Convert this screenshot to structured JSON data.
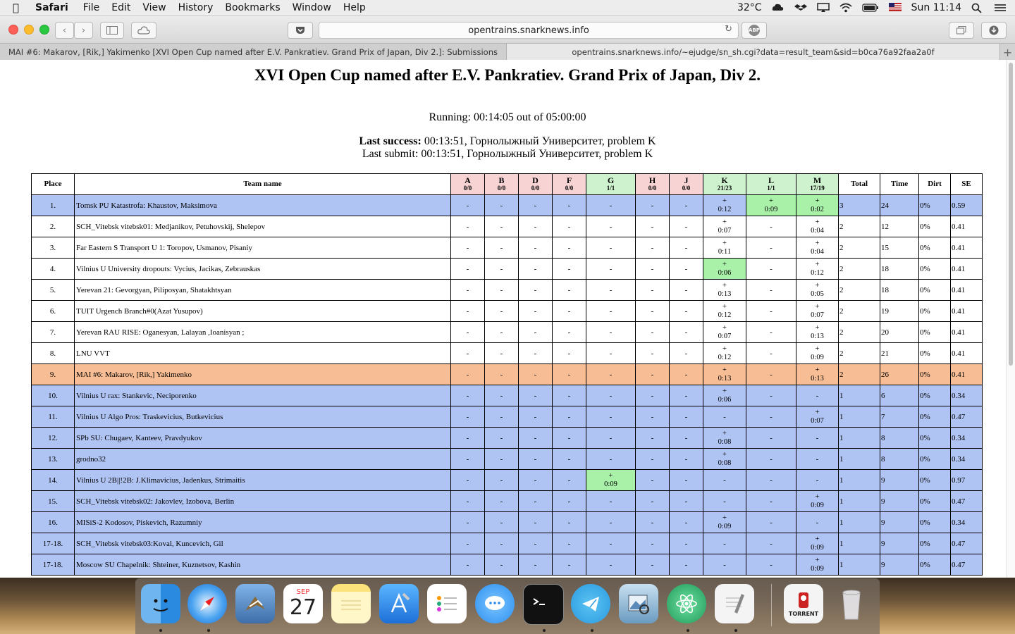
{
  "menubar": {
    "app": "Safari",
    "items": [
      "File",
      "Edit",
      "View",
      "History",
      "Bookmarks",
      "Window",
      "Help"
    ],
    "temperature": "32°C",
    "clock": "Sun 11:14"
  },
  "browser": {
    "url": "opentrains.snarknews.info",
    "tabs": [
      "MAI #6: Makarov, [Rik,] Yakimenko [XVI Open Cup named after E.V. Pankratiev. Grand Prix of Japan, Div 2.]: Submissions",
      "opentrains.snarknews.info/~ejudge/sn_sh.cgi?data=result_team&sid=b0ca76a92faa2a0f"
    ],
    "new_tab": "+"
  },
  "page": {
    "title": "XVI Open Cup named after E.V. Pankratiev. Grand Prix of Japan, Div 2.",
    "running": "Running: 00:14:05 out of 05:00:00",
    "last_success_label": "Last success:",
    "last_success_value": " 00:13:51, Горнолыжный Университет, problem K",
    "last_submit": "Last submit: 00:13:51, Горнолыжный Университет, problem K"
  },
  "table": {
    "headers": {
      "place": "Place",
      "team": "Team name",
      "total": "Total",
      "time": "Time",
      "dirt": "Dirt",
      "se": "SE"
    },
    "problems": [
      {
        "letter": "A",
        "count": "0/0",
        "color": "red"
      },
      {
        "letter": "B",
        "count": "0/0",
        "color": "red"
      },
      {
        "letter": "D",
        "count": "0/0",
        "color": "red"
      },
      {
        "letter": "F",
        "count": "0/0",
        "color": "red"
      },
      {
        "letter": "G",
        "count": "1/1",
        "color": "green"
      },
      {
        "letter": "H",
        "count": "0/0",
        "color": "red"
      },
      {
        "letter": "J",
        "count": "0/0",
        "color": "red"
      },
      {
        "letter": "K",
        "count": "21/23",
        "color": "green"
      },
      {
        "letter": "L",
        "count": "1/1",
        "color": "green"
      },
      {
        "letter": "M",
        "count": "17/19",
        "color": "green"
      }
    ],
    "rows": [
      {
        "place": "1.",
        "team": "Tomsk PU Katastrofa: Khaustov, Maksimova",
        "style": "blue",
        "cells": [
          "-",
          "-",
          "-",
          "-",
          "-",
          "-",
          "-",
          "+|0:12",
          "+|0:09",
          "+|0:02"
        ],
        "first": [
          8,
          9
        ],
        "total": "3",
        "time": "24",
        "dirt": "0%",
        "se": "0.59"
      },
      {
        "place": "2.",
        "team": "SCH_Vitebsk vitebsk01: Medjanikov, Petuhovskij, Shelepov",
        "style": "white",
        "cells": [
          "-",
          "-",
          "-",
          "-",
          "-",
          "-",
          "-",
          "+|0:07",
          "-",
          "+|0:04"
        ],
        "first": [],
        "total": "2",
        "time": "12",
        "dirt": "0%",
        "se": "0.41"
      },
      {
        "place": "3.",
        "team": "Far Eastern S Transport U 1: Toropov, Usmanov, Pisaniy",
        "style": "white",
        "cells": [
          "-",
          "-",
          "-",
          "-",
          "-",
          "-",
          "-",
          "+|0:11",
          "-",
          "+|0:04"
        ],
        "first": [],
        "total": "2",
        "time": "15",
        "dirt": "0%",
        "se": "0.41"
      },
      {
        "place": "4.",
        "team": "Vilnius U University dropouts: Vycius, Jacikas, Zebrauskas",
        "style": "white",
        "cells": [
          "-",
          "-",
          "-",
          "-",
          "-",
          "-",
          "-",
          "+|0:06",
          "-",
          "+|0:12"
        ],
        "first": [
          7
        ],
        "total": "2",
        "time": "18",
        "dirt": "0%",
        "se": "0.41"
      },
      {
        "place": "5.",
        "team": "Yerevan 21: Gevorgyan, Piliposyan, Shatakhtsyan",
        "style": "white",
        "cells": [
          "-",
          "-",
          "-",
          "-",
          "-",
          "-",
          "-",
          "+|0:13",
          "-",
          "+|0:05"
        ],
        "first": [],
        "total": "2",
        "time": "18",
        "dirt": "0%",
        "se": "0.41"
      },
      {
        "place": "6.",
        "team": "TUIT Urgench Branch#0(Azat Yusupov)",
        "style": "white",
        "cells": [
          "-",
          "-",
          "-",
          "-",
          "-",
          "-",
          "-",
          "+|0:12",
          "-",
          "+|0:07"
        ],
        "first": [],
        "total": "2",
        "time": "19",
        "dirt": "0%",
        "se": "0.41"
      },
      {
        "place": "7.",
        "team": "Yerevan RAU RISE: Oganesyan, Lalayan ,Ioanisyan ;",
        "style": "white",
        "cells": [
          "-",
          "-",
          "-",
          "-",
          "-",
          "-",
          "-",
          "+|0:07",
          "-",
          "+|0:13"
        ],
        "first": [],
        "total": "2",
        "time": "20",
        "dirt": "0%",
        "se": "0.41"
      },
      {
        "place": "8.",
        "team": "LNU VVT",
        "style": "white",
        "cells": [
          "-",
          "-",
          "-",
          "-",
          "-",
          "-",
          "-",
          "+|0:12",
          "-",
          "+|0:09"
        ],
        "first": [],
        "total": "2",
        "time": "21",
        "dirt": "0%",
        "se": "0.41"
      },
      {
        "place": "9.",
        "team": "MAI #6: Makarov, [Rik,] Yakimenko",
        "style": "orange",
        "cells": [
          "-",
          "-",
          "-",
          "-",
          "-",
          "-",
          "-",
          "+|0:13",
          "-",
          "+|0:13"
        ],
        "first": [],
        "total": "2",
        "time": "26",
        "dirt": "0%",
        "se": "0.41"
      },
      {
        "place": "10.",
        "team": "Vilnius U rax: Stankevic, Neciporenko",
        "style": "blue",
        "cells": [
          "-",
          "-",
          "-",
          "-",
          "-",
          "-",
          "-",
          "+|0:06",
          "-",
          "-"
        ],
        "first": [],
        "total": "1",
        "time": "6",
        "dirt": "0%",
        "se": "0.34"
      },
      {
        "place": "11.",
        "team": "Vilnius U Algo Pros: Traskevicius, Butkevicius",
        "style": "blue",
        "cells": [
          "-",
          "-",
          "-",
          "-",
          "-",
          "-",
          "-",
          "-",
          "-",
          "+|0:07"
        ],
        "first": [],
        "total": "1",
        "time": "7",
        "dirt": "0%",
        "se": "0.47"
      },
      {
        "place": "12.",
        "team": "SPb SU: Chugaev, Kanteev, Pravdyukov",
        "style": "blue",
        "cells": [
          "-",
          "-",
          "-",
          "-",
          "-",
          "-",
          "-",
          "+|0:08",
          "-",
          "-"
        ],
        "first": [],
        "total": "1",
        "time": "8",
        "dirt": "0%",
        "se": "0.34"
      },
      {
        "place": "13.",
        "team": "grodno32",
        "style": "blue",
        "cells": [
          "-",
          "-",
          "-",
          "-",
          "-",
          "-",
          "-",
          "+|0:08",
          "-",
          "-"
        ],
        "first": [],
        "total": "1",
        "time": "8",
        "dirt": "0%",
        "se": "0.34"
      },
      {
        "place": "14.",
        "team": "Vilnius U 2B||!2B: J.Klimavicius, Jadenkus, Strimaitis",
        "style": "blue",
        "cells": [
          "-",
          "-",
          "-",
          "-",
          "+|0:09",
          "-",
          "-",
          "-",
          "-",
          "-"
        ],
        "first": [
          4
        ],
        "total": "1",
        "time": "9",
        "dirt": "0%",
        "se": "0.97"
      },
      {
        "place": "15.",
        "team": "SCH_Vitebsk vitebsk02: Jakovlev, Izobova, Berlin",
        "style": "blue",
        "cells": [
          "-",
          "-",
          "-",
          "-",
          "-",
          "-",
          "-",
          "-",
          "-",
          "+|0:09"
        ],
        "first": [],
        "total": "1",
        "time": "9",
        "dirt": "0%",
        "se": "0.47"
      },
      {
        "place": "16.",
        "team": "MISiS-2 Kodosov, Piskevich, Razumniy",
        "style": "blue",
        "cells": [
          "-",
          "-",
          "-",
          "-",
          "-",
          "-",
          "-",
          "+|0:09",
          "-",
          "-"
        ],
        "first": [],
        "total": "1",
        "time": "9",
        "dirt": "0%",
        "se": "0.34"
      },
      {
        "place": "17-18.",
        "team": "SCH_Vitebsk vitebsk03:Koval, Kuncevich, Gil",
        "style": "blue",
        "cells": [
          "-",
          "-",
          "-",
          "-",
          "-",
          "-",
          "-",
          "-",
          "-",
          "+|0:09"
        ],
        "first": [],
        "total": "1",
        "time": "9",
        "dirt": "0%",
        "se": "0.47"
      },
      {
        "place": "17-18.",
        "team": "Moscow SU Chapelnik: Shteiner, Kuznetsov, Kashin",
        "style": "blue",
        "cells": [
          "-",
          "-",
          "-",
          "-",
          "-",
          "-",
          "-",
          "-",
          "-",
          "+|0:09"
        ],
        "first": [],
        "total": "1",
        "time": "9",
        "dirt": "0%",
        "se": "0.47"
      }
    ]
  },
  "dock": {
    "calendar_month": "SEP",
    "calendar_day": "27",
    "apps": [
      "finder-icon",
      "safari-icon",
      "mail-icon",
      "calendar-icon",
      "notes-icon",
      "xcode-icon",
      "reminders-icon",
      "messages-icon",
      "terminal-icon",
      "telegram-icon",
      "preview-icon",
      "atom-icon",
      "textedit-icon",
      "torrent-icon",
      "trash-icon"
    ],
    "torrent_label": "TORRENT"
  }
}
